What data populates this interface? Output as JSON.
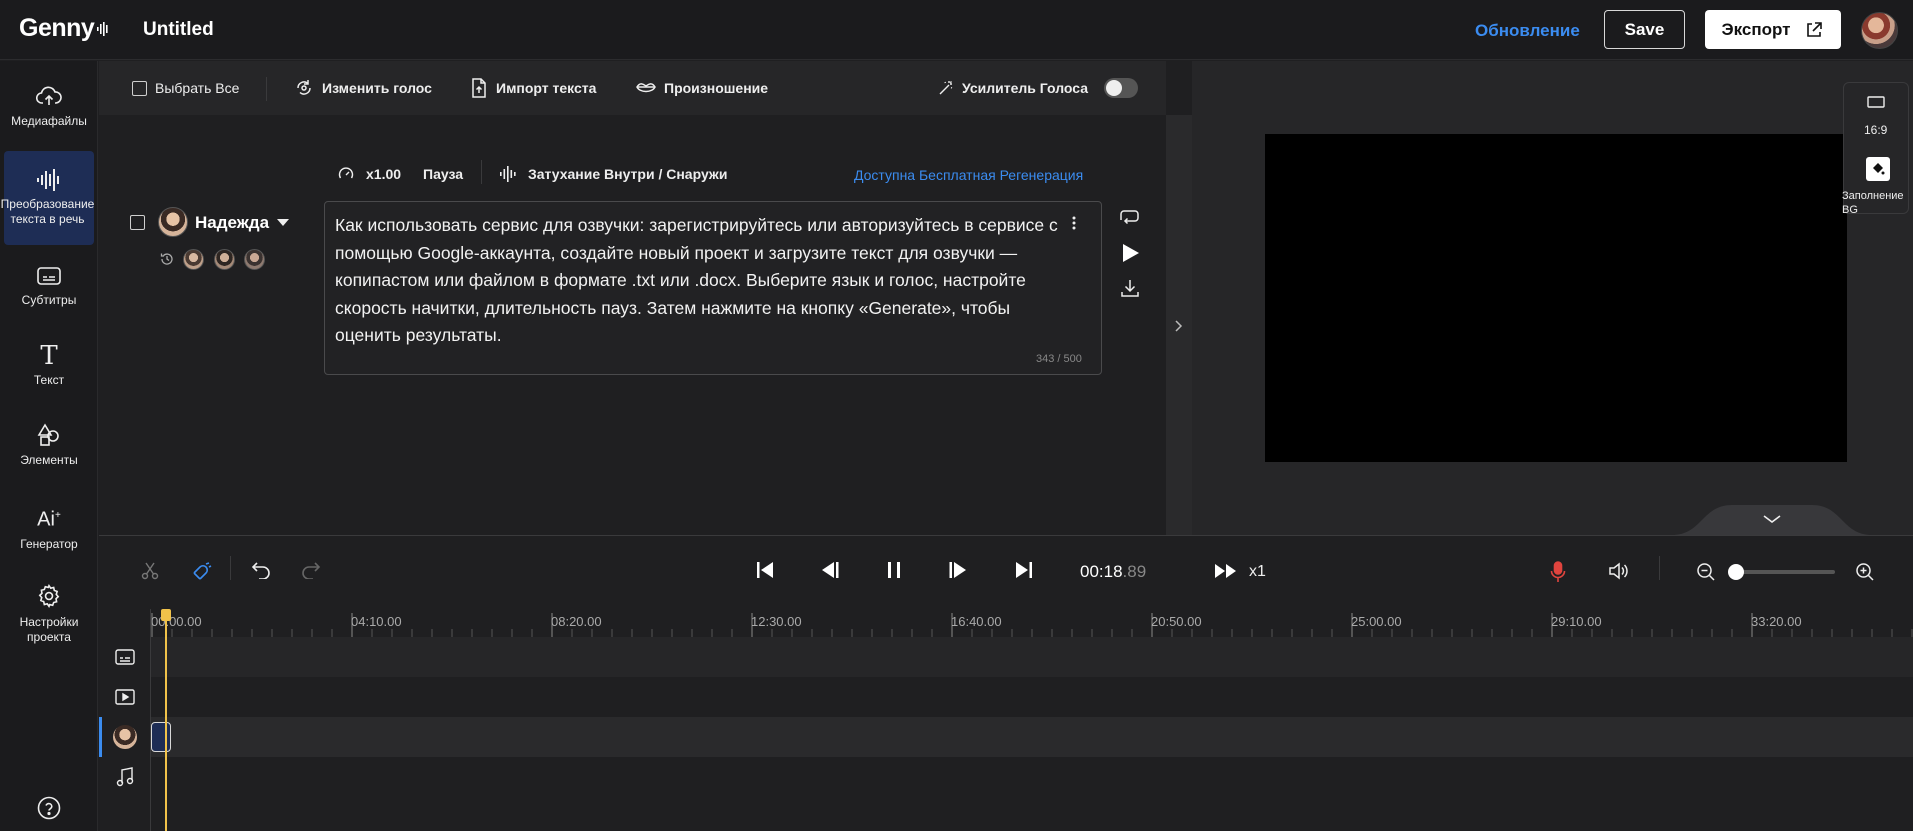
{
  "header": {
    "logo": "Genny",
    "doc_title": "Untitled",
    "update_link": "Обновление",
    "save_label": "Save",
    "export_label": "Экспорт"
  },
  "sidebar": {
    "items": [
      {
        "label": "Медиафайлы",
        "icon": "cloud-upload-icon"
      },
      {
        "label": "Преобразование текста в речь",
        "icon": "voice-wave-icon"
      },
      {
        "label": "Субтитры",
        "icon": "subtitles-icon"
      },
      {
        "label": "Текст",
        "icon": "text-icon"
      },
      {
        "label": "Элементы",
        "icon": "shapes-icon"
      },
      {
        "label": "Генератор",
        "icon": "ai-icon"
      },
      {
        "label": "Настройки проекта",
        "icon": "gear-icon"
      }
    ],
    "help_icon": "help-icon"
  },
  "toolbar": {
    "select_all": "Выбрать Все",
    "change_voice": "Изменить голос",
    "import_text": "Импорт текста",
    "pronunciation": "Произношение",
    "voice_enhancer": "Усилитель Голоса"
  },
  "editor": {
    "speed": "x1.00",
    "pause": "Пауза",
    "fade": "Затухание Внутри / Снаружи",
    "regen": "Доступна Бесплатная Регенерация",
    "voice_name": "Надежда",
    "text": "Как использовать сервис для озвучки: зарегистрируйтесь или авторизуйтесь в сервисе с помощью Google-аккаунта, создайте новый проект и загрузите текст для озвучки — копипастом или файлом в формате .txt или .docx. Выберите язык и голос, настройте скорость начитки, длительность пауз. Затем нажмите на кнопку «Generate», чтобы оценить результаты.",
    "char_count": "343 / 500"
  },
  "preview": {
    "aspect_ratio": "16:9",
    "fill_bg": "Заполнение BG"
  },
  "timeline": {
    "time_main": "00:18",
    "time_ms": ".89",
    "speed": "x1",
    "ruler": [
      "00:00.00",
      "04:10.00",
      "08:20.00",
      "12:30.00",
      "16:40.00",
      "20:50.00",
      "25:00.00",
      "29:10.00",
      "33:20.00"
    ]
  },
  "colors": {
    "accent": "#3b8cf0",
    "playhead": "#f0c24a",
    "active_bg": "#1e2d55",
    "mic": "#e0443e"
  }
}
